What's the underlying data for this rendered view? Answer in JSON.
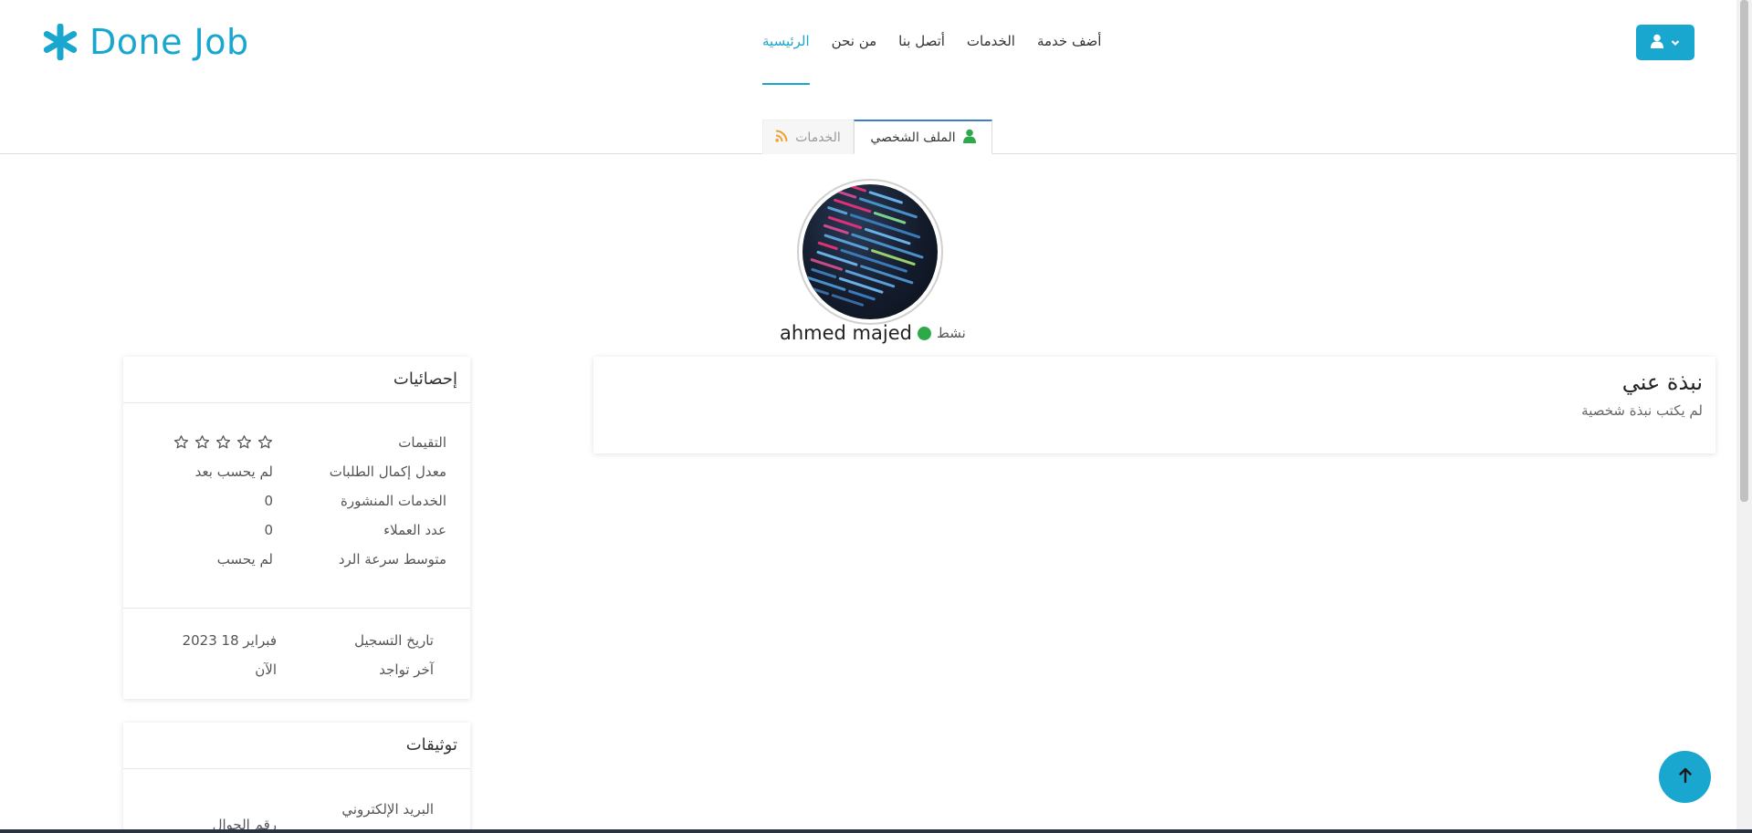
{
  "header": {
    "logo_text": "Done Job",
    "logo_icon": "asterisk-icon",
    "nav": [
      {
        "label": "الرئيسية",
        "active": true
      },
      {
        "label": "من نحن",
        "active": false
      },
      {
        "label": "أتصل بنا",
        "active": false
      },
      {
        "label": "الخدمات",
        "active": false
      },
      {
        "label": "أضف خدمة",
        "active": false
      }
    ],
    "user_menu_icons": [
      "user-icon",
      "chevron-down-icon"
    ]
  },
  "tabs": {
    "profile_label": "الملف الشخصي",
    "services_label": "الخدمات",
    "active": "profile"
  },
  "profile": {
    "name": "ahmed majed",
    "status": "نشط",
    "status_color": "#2ea94a"
  },
  "about": {
    "title": "نبذة عني",
    "text": "لم يكتب نبذة شخصية"
  },
  "stats": {
    "title": "إحصائيات",
    "rating_label": "التقيمات",
    "rating_stars": 0,
    "rating_max": 5,
    "rows": [
      {
        "label": "معدل إكمال الطلبات",
        "value": "لم يحسب بعد"
      },
      {
        "label": "الخدمات المنشورة",
        "value": "0"
      },
      {
        "label": "عدد العملاء",
        "value": "0"
      },
      {
        "label": "متوسط سرعة الرد",
        "value": "لم يحسب"
      }
    ],
    "dates": [
      {
        "label": "تاريخ التسجيل",
        "value": "فبراير 18 2023"
      },
      {
        "label": "آخر تواجد",
        "value": "الآن"
      }
    ]
  },
  "verifications": {
    "title": "توثيقات",
    "email_label": "البريد الإلكتروني",
    "phone_label": "رقم الجوال"
  },
  "colors": {
    "accent": "#1aa7cf",
    "tab_border": "#3d7fc9",
    "online": "#2ea94a"
  }
}
